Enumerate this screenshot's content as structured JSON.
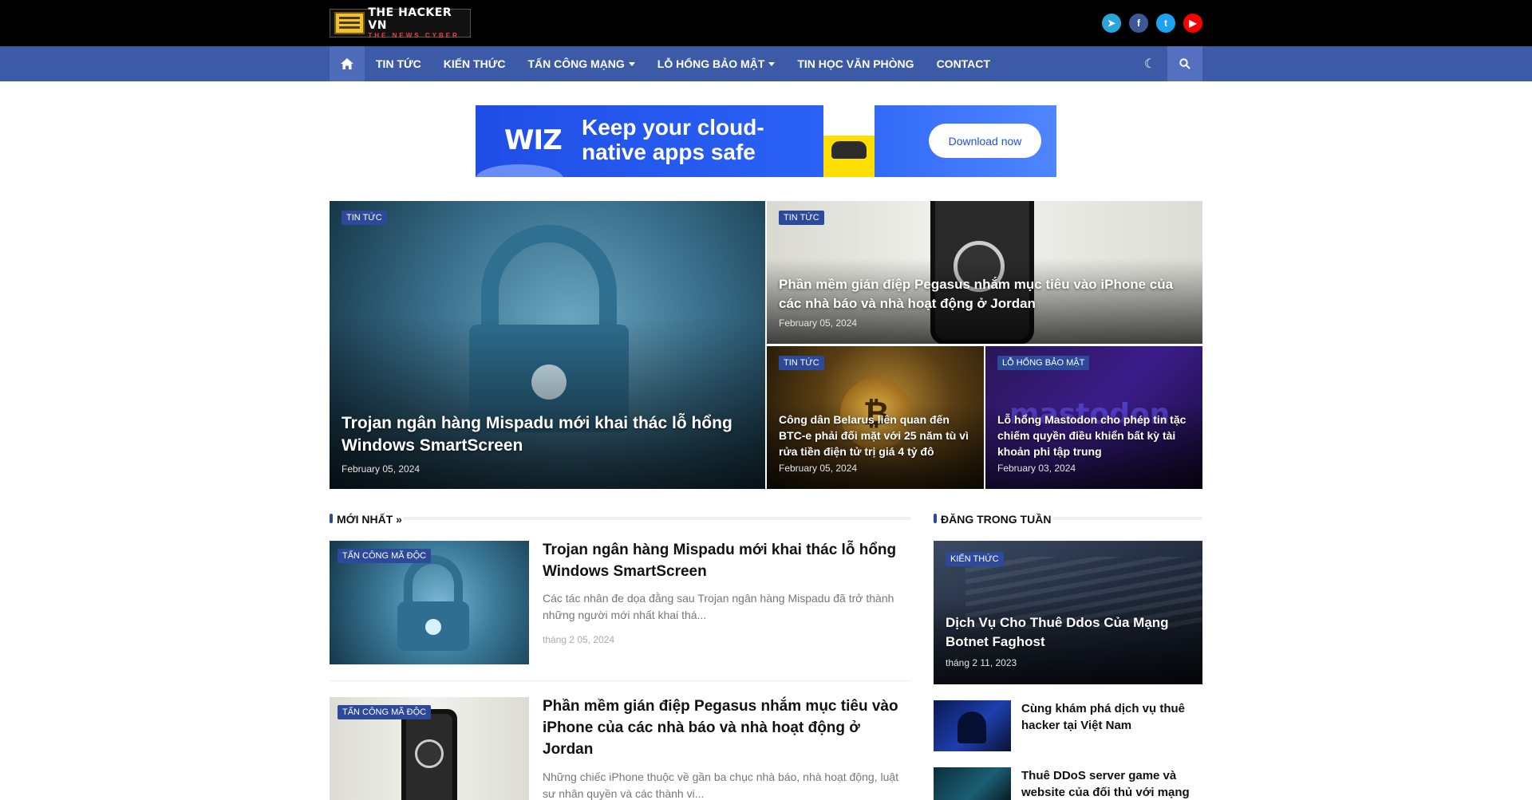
{
  "site": {
    "logo_title": "THE HACKER VN",
    "logo_subtitle": "THE NEWS CYBER"
  },
  "social": {
    "telegram_glyph": "➤",
    "facebook_glyph": "f",
    "twitter_glyph": "t",
    "youtube_glyph": "▶"
  },
  "nav": {
    "items": [
      {
        "label": "TIN TỨC"
      },
      {
        "label": "KIẾN THỨC"
      },
      {
        "label": "TẤN CÔNG MẠNG"
      },
      {
        "label": "LỖ HỔNG BẢO MẬT"
      },
      {
        "label": "TIN HỌC VĂN PHÒNG"
      },
      {
        "label": "CONTACT"
      }
    ],
    "moon_glyph": "☾"
  },
  "banner": {
    "brand": "WIZ",
    "headline": "Keep your cloud-native apps safe",
    "button": "Download now"
  },
  "featured": [
    {
      "tag": "TIN TỨC",
      "title": "Trojan ngân hàng Mispadu mới khai thác lỗ hổng Windows SmartScreen",
      "date": "February 05, 2024"
    },
    {
      "tag": "TIN TỨC",
      "title": "Phần mềm gián điệp Pegasus nhắm mục tiêu vào iPhone của các nhà báo và nhà hoạt động ở Jordan",
      "date": "February 05, 2024"
    },
    {
      "tag": "TIN TỨC",
      "title": "Công dân Belarus liên quan đến BTC-e phải đối mặt với 25 năm tù vì rửa tiền điện tử trị giá 4 tỷ đô",
      "date": "February 05, 2024"
    },
    {
      "tag": "LỖ HỔNG BẢO MẬT",
      "title": "Lỗ hổng Mastodon cho phép tin tặc chiếm quyền điều khiển bất kỳ tài khoản phi tập trung",
      "date": "February 03, 2024"
    }
  ],
  "latest": {
    "heading": "MỚI NHẤT »",
    "posts": [
      {
        "tag": "TẤN CÔNG MÃ ĐỘC",
        "title": "Trojan ngân hàng Mispadu mới khai thác lỗ hổng Windows SmartScreen",
        "excerpt": "Các tác nhân đe dọa đằng sau Trojan ngân hàng Mispadu đã trở thành những người mới nhất khai thá...",
        "date": "tháng 2 05, 2024"
      },
      {
        "tag": "TẤN CÔNG MÃ ĐỘC",
        "title": "Phần mềm gián điệp Pegasus nhắm mục tiêu vào iPhone của các nhà báo và nhà hoạt động ở Jordan",
        "excerpt": "Những chiếc iPhone thuộc về gần ba chục nhà báo, nhà hoạt động, luật sư nhân quyền và các thành vi...",
        "date": ""
      }
    ]
  },
  "weekly": {
    "heading": "ĐĂNG TRONG TUẦN",
    "top": {
      "tag": "KIẾN THỨC",
      "title": "Dịch Vụ Cho Thuê Ddos Của Mạng Botnet Faghost",
      "date": "tháng 2 11, 2023"
    },
    "items": [
      {
        "title": "Cùng khám phá dịch vụ thuê hacker tại Việt Nam"
      },
      {
        "title": "Thuê DDoS server game và website của đối thủ với mạng"
      }
    ]
  }
}
